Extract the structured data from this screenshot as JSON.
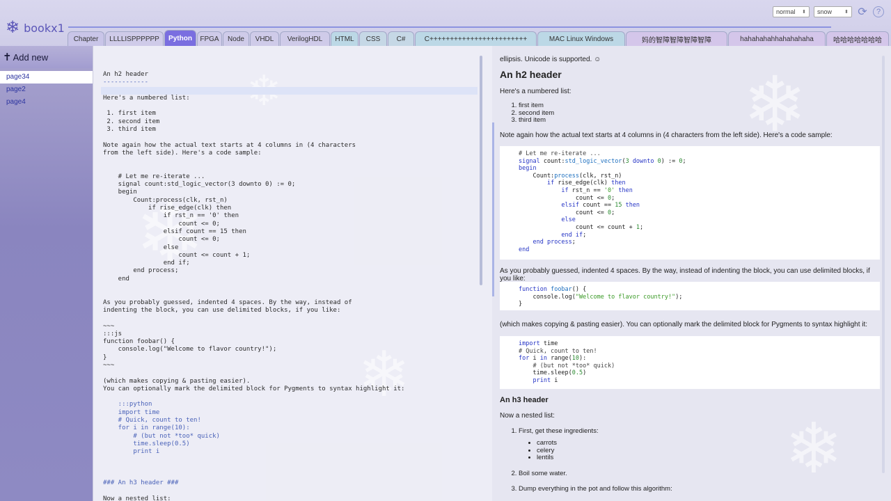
{
  "app": {
    "name": "bookx1",
    "logo_icon": "snowflake-icon"
  },
  "controls": {
    "mode": "normal",
    "theme": "snow",
    "refresh_icon": "refresh-icon",
    "help_label": "?"
  },
  "tabs": [
    {
      "label": "Chapter",
      "color": "#c9c5e8"
    },
    {
      "label": "LLLLISPPPPPP",
      "color": "#cfcbe9"
    },
    {
      "label": "Python",
      "color": "#7a6ee0",
      "active": true
    },
    {
      "label": "FPGA",
      "color": "#cfcbe9"
    },
    {
      "label": "Node",
      "color": "#cfcbe9"
    },
    {
      "label": "VHDL",
      "color": "#cfcbe9"
    },
    {
      "label": "VerilogHDL",
      "color": "#cfcbe9"
    },
    {
      "label": "HTML",
      "color": "#bcd8e6"
    },
    {
      "label": "CSS",
      "color": "#c6d8e6"
    },
    {
      "label": "C#",
      "color": "#c6d8e6"
    },
    {
      "label": "C++++++++++++++++++++++++",
      "color": "#bcd8e6"
    },
    {
      "label": "MAC Linux Windows",
      "color": "#bcd8e6"
    },
    {
      "label": "妈的智障智障智障智障",
      "color": "#d4c6ea"
    },
    {
      "label": "hahahahahhahahahaha",
      "color": "#d4c6ea"
    },
    {
      "label": "哈哈哈哈哈哈哈",
      "color": "#d4c6ea"
    }
  ],
  "sidebar": {
    "add_new": "Add new",
    "add_icon": "plus-cross-icon",
    "pages": [
      "page34",
      "page2",
      "page4"
    ],
    "selected_index": 0
  },
  "editor": {
    "lines": [
      "An h2 header",
      "------------",
      "",
      "Here's a numbered list:",
      "",
      " 1. first item",
      " 2. second item",
      " 3. third item",
      "",
      "Note again how the actual text starts at 4 columns in (4 characters",
      "from the left side). Here's a code sample:",
      "",
      "",
      "    # Let me re-iterate ...",
      "    signal count:std_logic_vector(3 downto 0) := 0;",
      "    begin",
      "        Count:process(clk, rst_n)",
      "            if rise_edge(clk) then",
      "                if rst_n == '0' then",
      "                    count <= 0;",
      "                elsif count == 15 then",
      "                    count <= 0;",
      "                else",
      "                    count <= count + 1;",
      "                end if;",
      "        end process;",
      "    end",
      "",
      "",
      "As you probably guessed, indented 4 spaces. By the way, instead of",
      "indenting the block, you can use delimited blocks, if you like:",
      "",
      "~~~",
      ":::js",
      "function foobar() {",
      "    console.log(\"Welcome to flavor country!\");",
      "}",
      "~~~",
      "",
      "(which makes copying & pasting easier).",
      "You can optionally mark the delimited block for Pygments to syntax highlight it:",
      "",
      "    :::python",
      "    import time",
      "    # Quick, count to ten!",
      "    for i in range(10):",
      "        # (but not *too* quick)",
      "        time.sleep(0.5)",
      "        print i",
      "",
      "",
      "",
      "### An h3 header ###",
      "",
      "Now a nested list:"
    ]
  },
  "preview": {
    "intro": "ellipsis. Unicode is supported. ☺",
    "h2": "An h2 header",
    "numbered_intro": "Here's a numbered list:",
    "numbered": [
      "first item",
      "second item",
      "third item"
    ],
    "note": "Note again how the actual text starts at 4 columns in (4 characters from the left side). Here's a code sample:",
    "guess": "As you probably guessed, indented 4 spaces. By the way, instead of indenting the block, you can use delimited blocks, if you like:",
    "copy": "(which makes copying & pasting easier). You can optionally mark the delimited block for Pygments to syntax highlight it:",
    "h3": "An h3 header",
    "nested_intro": "Now a nested list:",
    "steps": [
      "First, get these ingredients:",
      "Boil some water.",
      "Dump everything in the pot and follow this algorithm:"
    ],
    "ingredients": [
      "carrots",
      "celery",
      "lentils"
    ]
  }
}
